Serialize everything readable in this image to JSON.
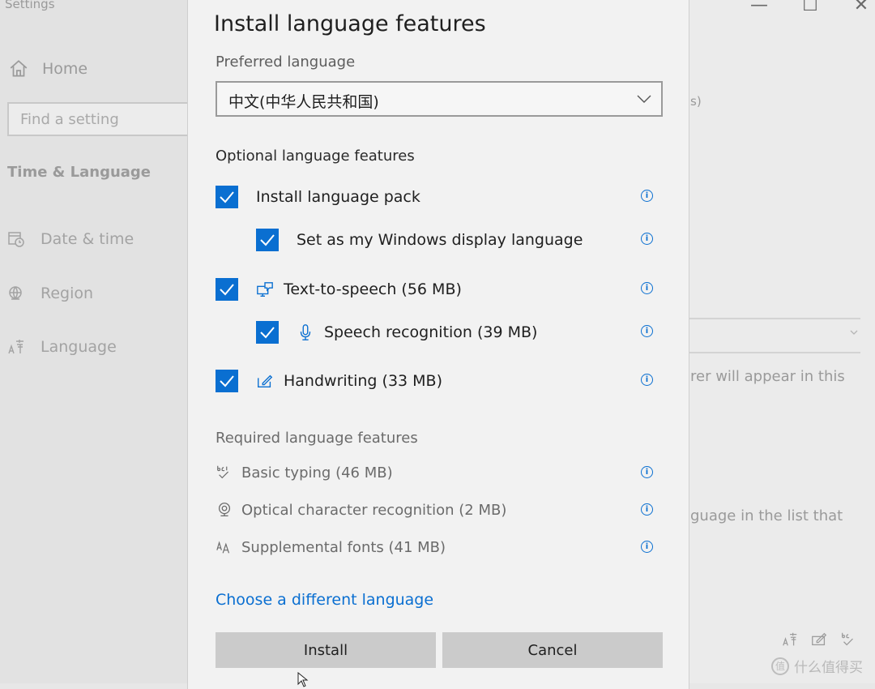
{
  "window": {
    "title": "Settings",
    "controls": {
      "minimize": "—",
      "maximize": "☐",
      "close": "✕"
    }
  },
  "sidebar": {
    "home_label": "Home",
    "search_placeholder": "Find a setting",
    "section_title": "Time & Language",
    "items": [
      {
        "label": "Date & time",
        "icon": "calendar-clock-icon"
      },
      {
        "label": "Region",
        "icon": "globe-icon"
      },
      {
        "label": "Language",
        "icon": "language-icon"
      }
    ]
  },
  "background_text": {
    "paren_fragment": "s)",
    "line1": "rer will appear in this",
    "line2": "guage in the list that"
  },
  "dialog": {
    "title": "Install language features",
    "preferred_language_label": "Preferred language",
    "preferred_language_value": "中文(中华人民共和国)",
    "optional_label": "Optional language features",
    "optional_features": [
      {
        "label": "Install language pack",
        "checked": true,
        "icon": ""
      },
      {
        "label": "Set as my Windows display language",
        "checked": true,
        "icon": ""
      },
      {
        "label": "Text-to-speech (56 MB)",
        "checked": true,
        "icon": "speech-bubble-monitor-icon"
      },
      {
        "label": "Speech recognition (39 MB)",
        "checked": true,
        "icon": "microphone-icon"
      },
      {
        "label": "Handwriting (33 MB)",
        "checked": true,
        "icon": "pen-box-icon"
      }
    ],
    "required_label": "Required language features",
    "required_features": [
      {
        "label": "Basic typing (46 MB)",
        "icon": "abc-check-icon"
      },
      {
        "label": "Optical character recognition (2 MB)",
        "icon": "webcam-icon"
      },
      {
        "label": "Supplemental fonts (41 MB)",
        "icon": "font-aa-icon"
      }
    ],
    "choose_link": "Choose a different language",
    "install_button": "Install",
    "cancel_button": "Cancel",
    "info_glyph": "i"
  },
  "watermark": {
    "logo_text": "值",
    "text": "什么值得买"
  },
  "colors": {
    "accent": "#0a6fd1",
    "dialog_bg": "#f2f2f2",
    "button_bg": "#cbcbcb"
  }
}
